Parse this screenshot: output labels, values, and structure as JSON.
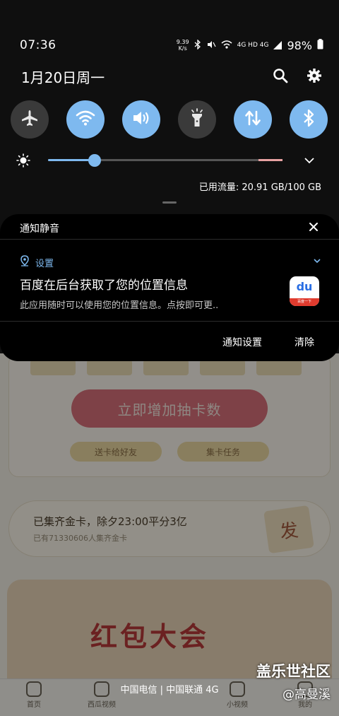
{
  "status_bar": {
    "time": "07:36",
    "net_speed_value": "9.39",
    "net_speed_unit": "K/s",
    "signal_labels": "4G  HD 4G",
    "battery": "98%"
  },
  "header": {
    "date": "1月20日周一"
  },
  "quick_tiles": [
    {
      "name": "airplane",
      "state": "off"
    },
    {
      "name": "wifi",
      "state": "on"
    },
    {
      "name": "sound",
      "state": "on"
    },
    {
      "name": "flashlight",
      "state": "off"
    },
    {
      "name": "mobile-data",
      "state": "on"
    },
    {
      "name": "bluetooth",
      "state": "on"
    }
  ],
  "brightness": {
    "level_fraction": 0.2
  },
  "data_usage": "已用流量: 20.91 GB/100 GB",
  "notification": {
    "section_title": "通知静音",
    "app_name": "设置",
    "title": "百度在后台获取了您的位置信息",
    "body": "此应用随时可以使用您的位置信息。点按即可更..",
    "app_icon_text": "du",
    "app_icon_band": "百度一下",
    "actions": {
      "settings": "通知设置",
      "clear": "清除"
    }
  },
  "background_app": {
    "draw_button": "立即增加抽卡数",
    "pill_left": "送卡给好友",
    "pill_right": "集卡任务",
    "banner_title": "已集齐金卡，除夕23:00平分3亿",
    "banner_sub": "已有71330606人集齐金卡",
    "fa_card": "发",
    "hongbao_title": "红包大会",
    "tabs": [
      "首页",
      "西瓜视频",
      "",
      "小视频",
      "我的"
    ]
  },
  "carrier": "中国电信 | 中国联通 4G",
  "watermark": {
    "line1": "盖乐世社区",
    "line2": "@高曼溪"
  },
  "colors": {
    "accent": "#7eb9ef",
    "tile_off": "#3a3a3a",
    "panel_bg": "#1a1a1a",
    "notification_bg": "#000000"
  }
}
